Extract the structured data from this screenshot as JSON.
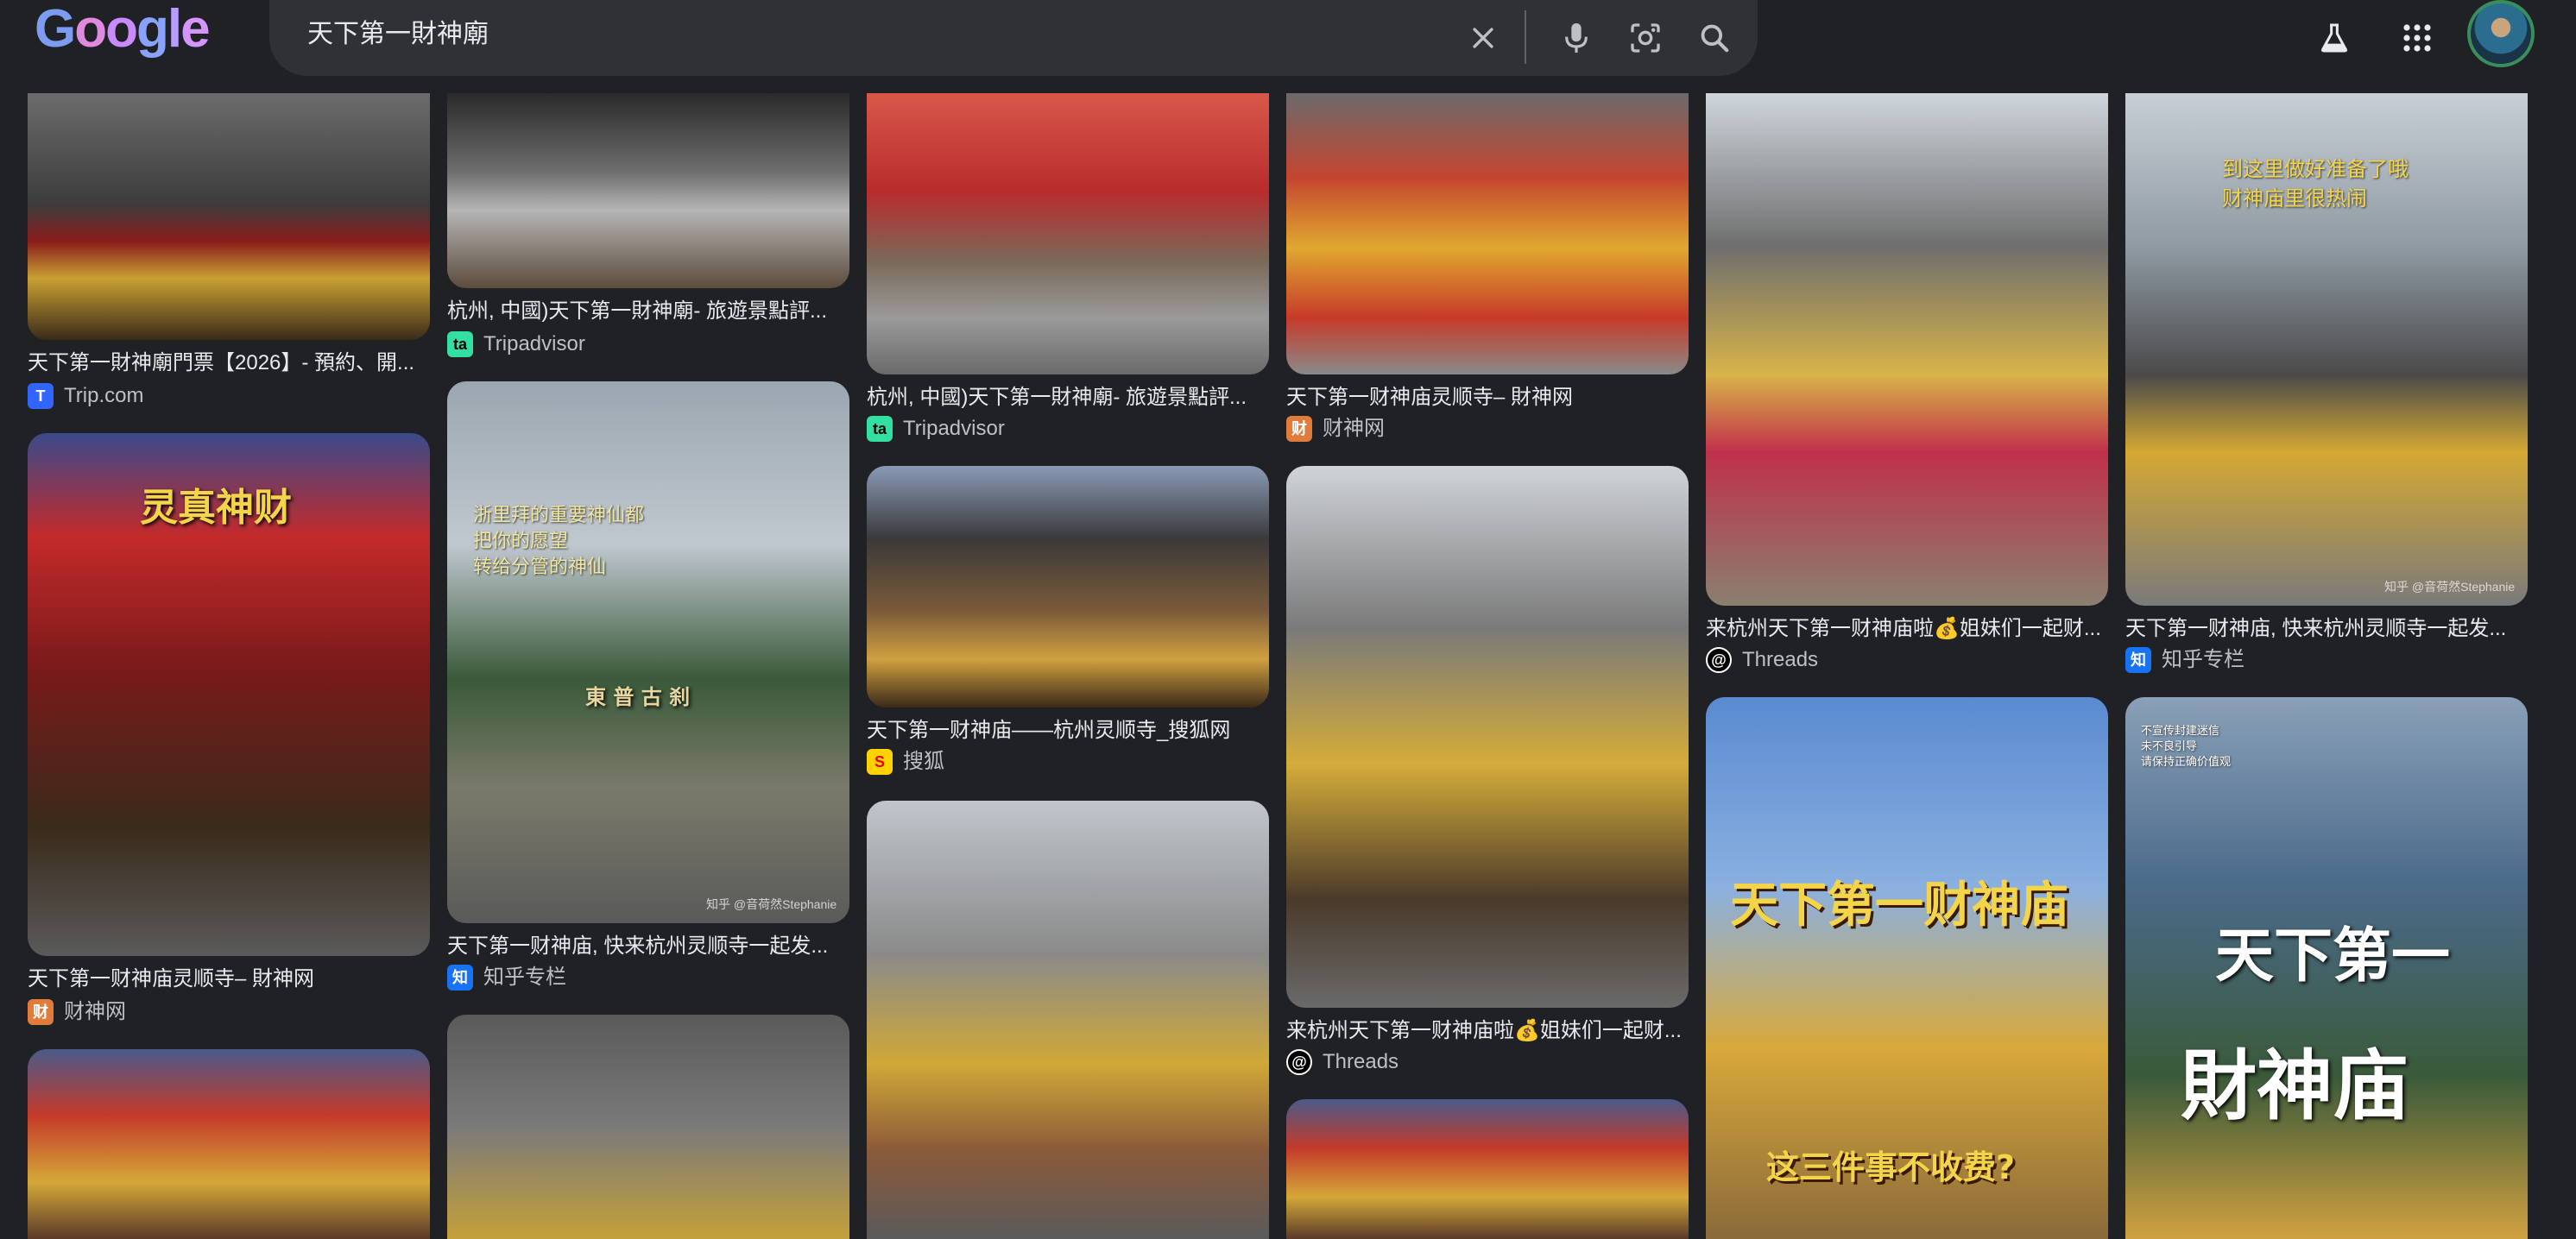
{
  "header": {
    "logo_text": "Google",
    "search_query": "天下第一財神廟"
  },
  "icons": {
    "clear": "close-icon",
    "voice": "microphone-icon",
    "lens": "camera-lens-icon",
    "search": "search-icon",
    "labs": "flask-icon",
    "apps": "apps-grid-icon"
  },
  "results": [
    {
      "title": "天下第一財神廟門票【2026】- 預約、開...",
      "source": "Trip.com",
      "favicon": "T"
    },
    {
      "title": "杭州, 中國)天下第一財神廟- 旅遊景點評...",
      "source": "Tripadvisor",
      "favicon": "ta"
    },
    {
      "title": "杭州, 中國)天下第一財神廟- 旅遊景點評...",
      "source": "Tripadvisor",
      "favicon": "ta"
    },
    {
      "title": "天下第一财神庙灵顺寺– 財神网",
      "source": "财神网",
      "favicon": "财"
    },
    {
      "title": "来杭州天下第一财神庙啦💰姐妹们一起财...",
      "source": "Threads",
      "favicon": "@"
    },
    {
      "title": "天下第一财神庙, 快来杭州灵顺寺一起发...",
      "source": "知乎专栏",
      "favicon": "知"
    },
    {
      "title": "天下第一财神庙灵顺寺– 財神网",
      "source": "财神网",
      "favicon": "财"
    },
    {
      "title": "天下第一财神庙, 快来杭州灵顺寺一起发...",
      "source": "知乎专栏",
      "favicon": "知"
    },
    {
      "title": "天下第一财神庙——杭州灵顺寺_搜狐网",
      "source": "搜狐",
      "favicon": "S"
    },
    {
      "title": "来杭州天下第一财神庙啦💰姐妹们一起财...",
      "source": "Threads",
      "favicon": "@"
    }
  ],
  "image_text": {
    "temple_sign": "灵真神财",
    "arch_sign": "東 普 古 刹",
    "zhihu_overlay_1": "浙里拜的重要神仙都",
    "zhihu_overlay_2": "把你的愿望",
    "zhihu_overlay_3": "转给分管的神仙",
    "zhihu_top_1": "到这里做好准备了哦",
    "zhihu_top_2": "财神庙里很热闹",
    "watermark": "知乎 @音荷然Stephanie",
    "video_title": "天下第一财神庙",
    "video_caption": "这三件事不收费?",
    "poster_small_1": "不宣传封建迷信",
    "poster_small_2": "未不良引导",
    "poster_small_3": "请保持正确价值观",
    "poster_big_1": "天下第一",
    "poster_big_2": "財神庙"
  }
}
